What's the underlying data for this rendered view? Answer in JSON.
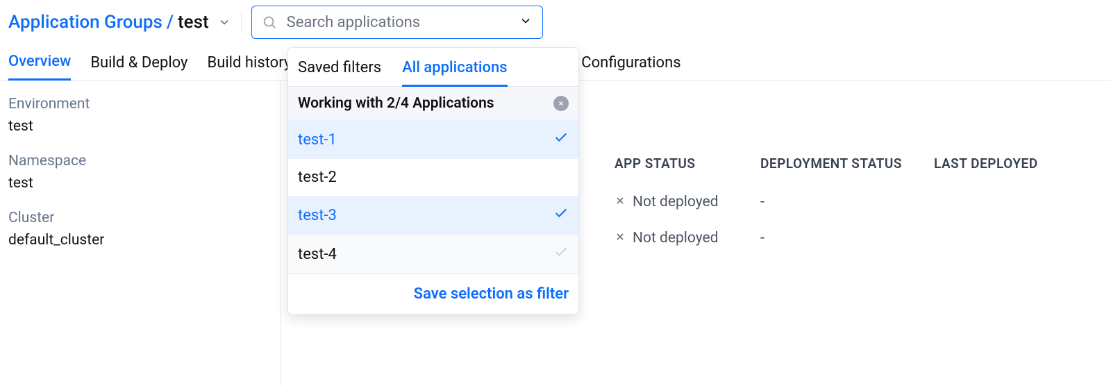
{
  "breadcrumb": {
    "root": "Application Groups",
    "separator": "/",
    "current": "test"
  },
  "search": {
    "placeholder": "Search applications"
  },
  "tabs": [
    {
      "label": "Overview",
      "active": true
    },
    {
      "label": "Build & Deploy",
      "active": false
    },
    {
      "label": "Build history",
      "active": false
    },
    {
      "label": "Configurations",
      "active": false
    }
  ],
  "sidebar": {
    "env_label": "Environment",
    "env_value": "test",
    "ns_label": "Namespace",
    "ns_value": "test",
    "cluster_label": "Cluster",
    "cluster_value": "default_cluster"
  },
  "table": {
    "headers": {
      "app_status": "APP STATUS",
      "deployment_status": "DEPLOYMENT STATUS",
      "last_deployed": "LAST DEPLOYED"
    },
    "rows": [
      {
        "app_status": "Not deployed",
        "deployment_status": "-",
        "last_deployed": ""
      },
      {
        "app_status": "Not deployed",
        "deployment_status": "-",
        "last_deployed": ""
      }
    ]
  },
  "popover": {
    "tabs": {
      "saved": "Saved filters",
      "all": "All applications"
    },
    "status_text": "Working with 2/4 Applications",
    "items": [
      {
        "label": "test-1",
        "selected": true,
        "hover": false
      },
      {
        "label": "test-2",
        "selected": false,
        "hover": false
      },
      {
        "label": "test-3",
        "selected": true,
        "hover": false
      },
      {
        "label": "test-4",
        "selected": false,
        "hover": true
      }
    ],
    "footer": "Save selection as filter"
  }
}
